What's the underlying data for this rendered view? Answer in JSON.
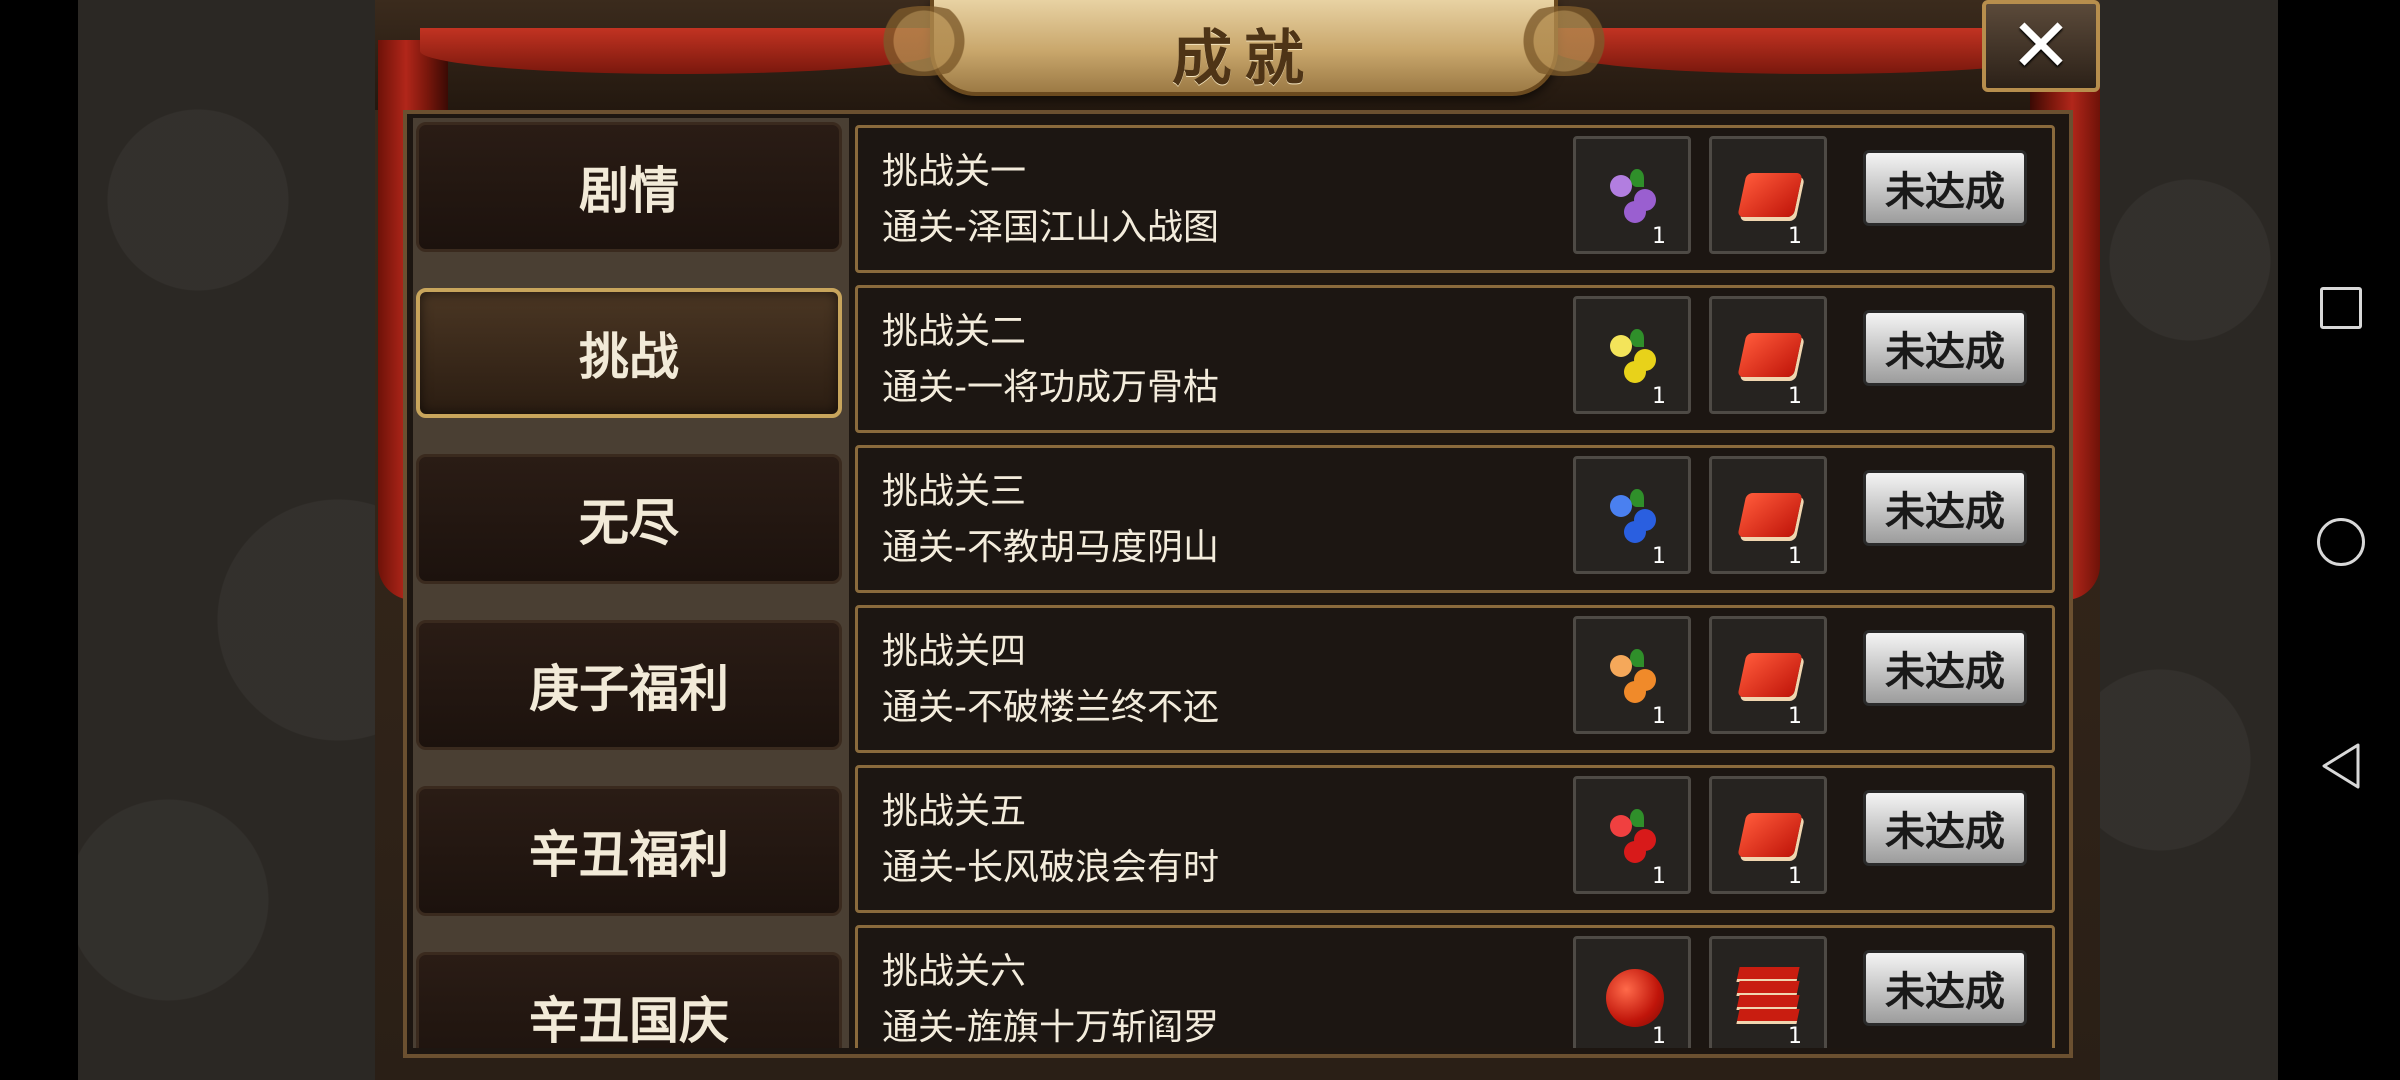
{
  "window": {
    "title": "成就",
    "close_label": "✕"
  },
  "categories": [
    {
      "label": "剧情",
      "active": false
    },
    {
      "label": "挑战",
      "active": true
    },
    {
      "label": "无尽",
      "active": false
    },
    {
      "label": "庚子福利",
      "active": false
    },
    {
      "label": "辛丑福利",
      "active": false
    },
    {
      "label": "辛丑国庆",
      "active": false
    }
  ],
  "achievements": [
    {
      "name": "挑战关一",
      "desc": "通关-泽国江山入战图",
      "reward1": {
        "icon": "purple-fruit-icon",
        "count": "1"
      },
      "reward2": {
        "icon": "red-book-icon",
        "count": "1"
      },
      "status": "未达成"
    },
    {
      "name": "挑战关二",
      "desc": "通关-一将功成万骨枯",
      "reward1": {
        "icon": "yellow-fruit-icon",
        "count": "1"
      },
      "reward2": {
        "icon": "red-book-icon",
        "count": "1"
      },
      "status": "未达成"
    },
    {
      "name": "挑战关三",
      "desc": "通关-不教胡马度阴山",
      "reward1": {
        "icon": "blue-fruit-icon",
        "count": "1"
      },
      "reward2": {
        "icon": "red-book-icon",
        "count": "1"
      },
      "status": "未达成"
    },
    {
      "name": "挑战关四",
      "desc": "通关-不破楼兰终不还",
      "reward1": {
        "icon": "orange-fruit-icon",
        "count": "1"
      },
      "reward2": {
        "icon": "red-book-icon",
        "count": "1"
      },
      "status": "未达成"
    },
    {
      "name": "挑战关五",
      "desc": "通关-长风破浪会有时",
      "reward1": {
        "icon": "red-fruit-icon",
        "count": "1"
      },
      "reward2": {
        "icon": "red-book-icon",
        "count": "1"
      },
      "status": "未达成"
    },
    {
      "name": "挑战关六",
      "desc": "通关-旌旗十万斩阎罗",
      "reward1": {
        "icon": "red-pouch-icon",
        "count": "1"
      },
      "reward2": {
        "icon": "book-stack-icon",
        "count": "1"
      },
      "status": "未达成"
    }
  ],
  "colors": {
    "purple": "#9a5fd0",
    "yellow": "#e8d21a",
    "blue": "#2a5fe0",
    "orange": "#f08a2a",
    "red": "#d81a1a"
  }
}
